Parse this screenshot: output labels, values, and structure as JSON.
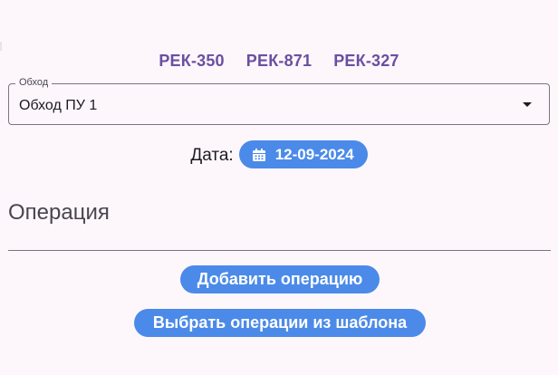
{
  "tags": [
    "РЕК-350",
    "РЕК-871",
    "РЕК-327"
  ],
  "obhod": {
    "label": "Обход",
    "value": "Обход ПУ 1"
  },
  "date": {
    "label": "Дата:",
    "value": "12-09-2024",
    "icon": "calendar-icon"
  },
  "operations": {
    "title": "Операция",
    "add_button": "Добавить операцию",
    "template_button": "Выбрать операции из шаблона"
  },
  "colors": {
    "background": "#fdf7fc",
    "accent": "#4b8ae8",
    "tag": "#6a4fa0"
  }
}
